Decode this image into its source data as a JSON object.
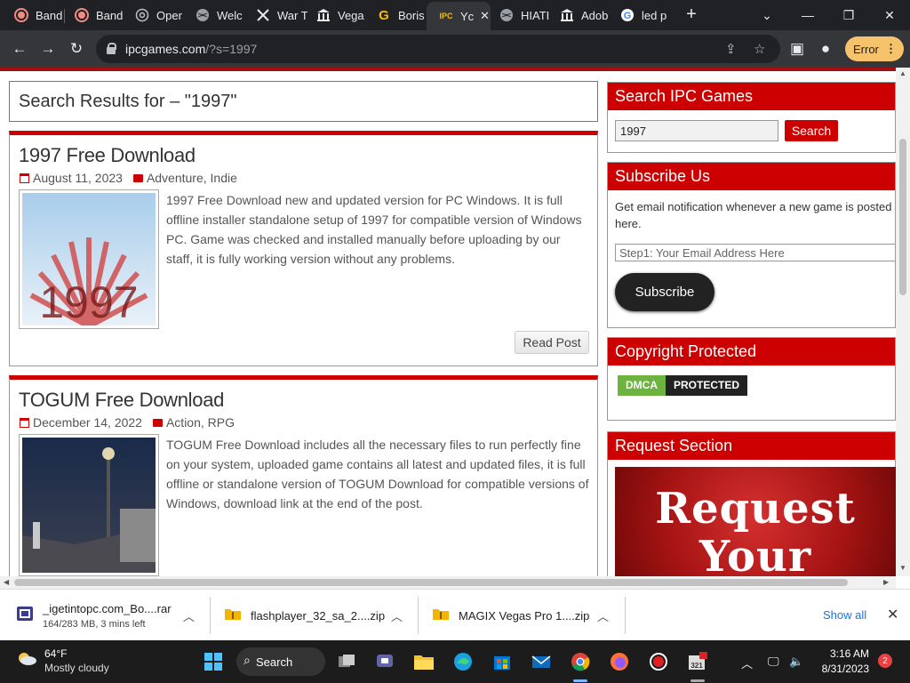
{
  "browser": {
    "tabs": [
      {
        "label": "Band",
        "icon": "red-record-icon"
      },
      {
        "label": "Band",
        "icon": "red-record-icon"
      },
      {
        "label": "Oper",
        "icon": "openai-icon"
      },
      {
        "label": "Welc",
        "icon": "globe-icon"
      },
      {
        "label": "War T",
        "icon": "war-icon"
      },
      {
        "label": "Vega",
        "icon": "bank-icon"
      },
      {
        "label": "Boris",
        "icon": "g-icon"
      },
      {
        "label": "Yc",
        "icon": "ipc-icon"
      },
      {
        "label": "HIATI",
        "icon": "globe-icon"
      },
      {
        "label": "Adob",
        "icon": "bank-icon"
      },
      {
        "label": "led p",
        "icon": "google-icon"
      }
    ],
    "new_tab": "+",
    "url_domain": "ipcgames.com",
    "url_path": "/?s=1997",
    "error_label": "Error"
  },
  "page": {
    "search_heading": "Search Results for – \"1997\"",
    "posts": [
      {
        "title": "1997 Free Download",
        "date": "August 11, 2023",
        "categories": [
          "Adventure",
          "Indie"
        ],
        "thumb_text": "1997",
        "excerpt": "1997 Free Download new and updated version for PC Windows. It is full offline installer standalone setup of 1997 for compatible version of Windows PC. Game was checked and installed manually before uploading by our staff, it is fully working version without any problems.",
        "read_label": "Read Post"
      },
      {
        "title": "TOGUM Free Download",
        "date": "December 14, 2022",
        "categories": [
          "Action",
          "RPG"
        ],
        "excerpt": "TOGUM Free Download includes all the necessary files to run perfectly fine on your system, uploaded game contains all latest and updated files, it is full offline or standalone version of TOGUM Download for compatible versions of Windows, download link at the end of the post."
      }
    ],
    "sidebar": {
      "search": {
        "title": "Search IPC Games",
        "value": "1997",
        "button": "Search"
      },
      "subscribe": {
        "title": "Subscribe Us",
        "text": "Get email notification whenever a new game is posted here.",
        "placeholder": "Step1: Your Email Address Here",
        "button": "Subscribe"
      },
      "copyright": {
        "title": "Copyright Protected",
        "badge_left": "DMCA",
        "badge_right": "PROTECTED"
      },
      "request": {
        "title": "Request Section",
        "image_text_1": "Request",
        "image_text_2": "Your"
      }
    }
  },
  "downloads": {
    "items": [
      {
        "name": "_igetintopc.com_Bo....rar",
        "sub": "164/283 MB, 3 mins left",
        "icon": "winrar-icon"
      },
      {
        "name": "flashplayer_32_sa_2....zip",
        "sub": "",
        "icon": "zip-folder-icon"
      },
      {
        "name": "MAGIX Vegas Pro 1....zip",
        "sub": "",
        "icon": "zip-folder-icon"
      }
    ],
    "show_all": "Show all"
  },
  "taskbar": {
    "temp": "64°F",
    "condition": "Mostly cloudy",
    "search_label": "Search",
    "time": "3:16 AM",
    "date": "8/31/2023",
    "notifications": "2"
  },
  "colors": {
    "accent": "#cc0000",
    "chrome_dark": "#202124",
    "link": "#1a73e8"
  }
}
